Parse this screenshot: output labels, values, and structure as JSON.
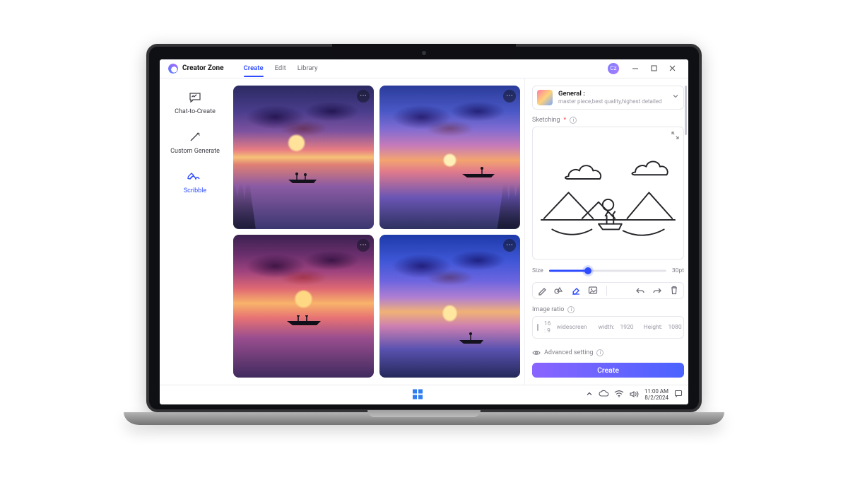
{
  "app": {
    "name": "Creator Zone",
    "avatar_initials": "Cz"
  },
  "tabs": [
    {
      "id": "create",
      "label": "Create",
      "active": true
    },
    {
      "id": "edit",
      "label": "Edit",
      "active": false
    },
    {
      "id": "library",
      "label": "Library",
      "active": false
    }
  ],
  "sidenav": [
    {
      "id": "chat",
      "label": "Chat-to-Create",
      "active": false
    },
    {
      "id": "custom",
      "label": "Custom Generate",
      "active": false
    },
    {
      "id": "scribble",
      "label": "Scribble",
      "active": true
    }
  ],
  "style": {
    "name": "General :",
    "subtitle": "master piece,best quality,highest detailed"
  },
  "sketch": {
    "label": "Sketching",
    "required": true,
    "brush": {
      "size_label": "Size",
      "value_label": "30pt",
      "percent": 33
    },
    "tools": {
      "pencil": "pencil-icon",
      "shapes": "shapes-icon",
      "eraser": "eraser-icon",
      "image": "image-icon",
      "undo": "undo-icon",
      "redo": "redo-icon",
      "trash": "trash-icon",
      "active": "eraser"
    }
  },
  "image_ratio": {
    "label": "Image ratio",
    "ratio": "16 : 9",
    "ratio_name": "widescreen",
    "width_label": "width:",
    "width_value": "1920",
    "height_label": "Height:",
    "height_value": "1080"
  },
  "advanced": {
    "label": "Advanced setting"
  },
  "create_button": "Create",
  "system": {
    "time": "11:00 AM",
    "date": "8/2/2024"
  }
}
